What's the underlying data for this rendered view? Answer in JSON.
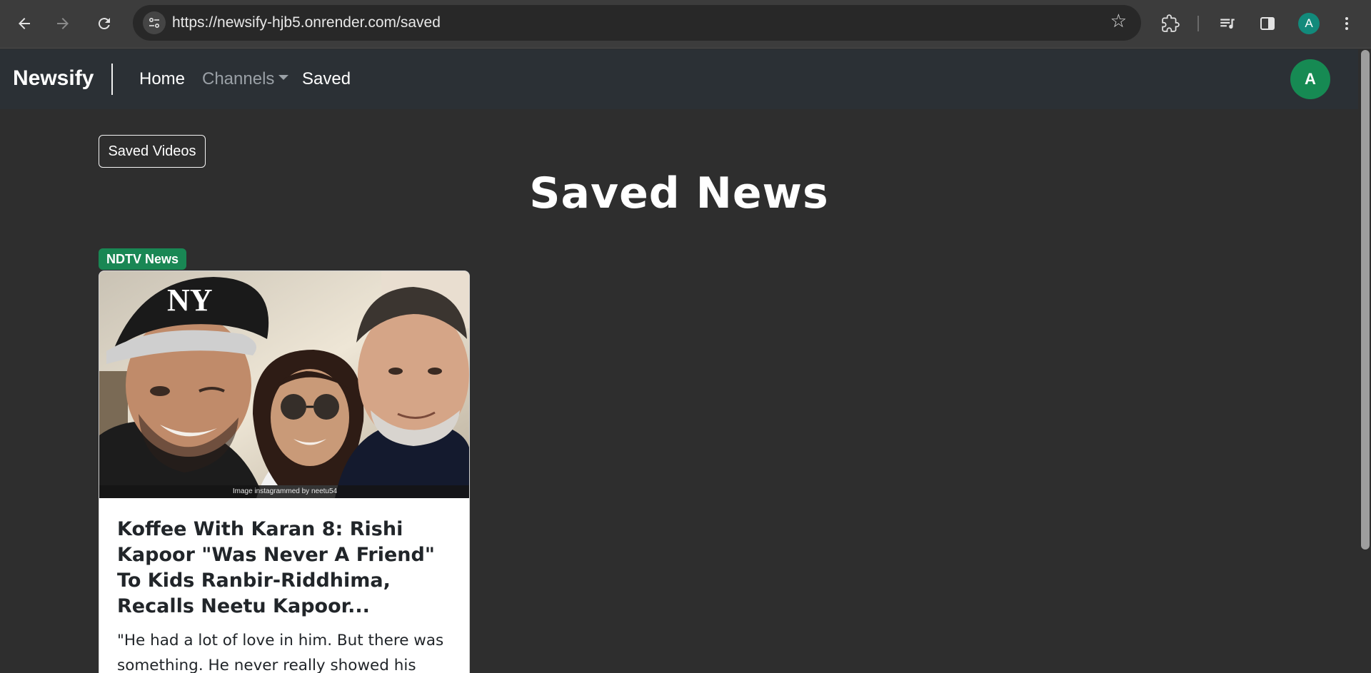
{
  "browser": {
    "url": "https://newsify-hjb5.onrender.com/saved",
    "profile_initial": "A"
  },
  "navbar": {
    "brand": "Newsify",
    "links": {
      "home": "Home",
      "channels": "Channels",
      "saved": "Saved"
    },
    "user_initial": "A"
  },
  "main": {
    "saved_videos_button": "Saved Videos",
    "title": "Saved News",
    "cards": [
      {
        "source": "NDTV News",
        "image_caption": "Image instagrammed by neetu54",
        "title": "Koffee With Karan 8: Rishi Kapoor \"Was Never A Friend\" To Kids Ranbir-Riddhima, Recalls Neetu Kapoor...",
        "description": "\"He had a lot of love in him. But there was something. He never really showed his"
      }
    ]
  },
  "colors": {
    "page_bg": "#2e2e2e",
    "navbar_bg": "#2b3035",
    "badge_green": "#198754",
    "avatar_green": "#168a53"
  }
}
